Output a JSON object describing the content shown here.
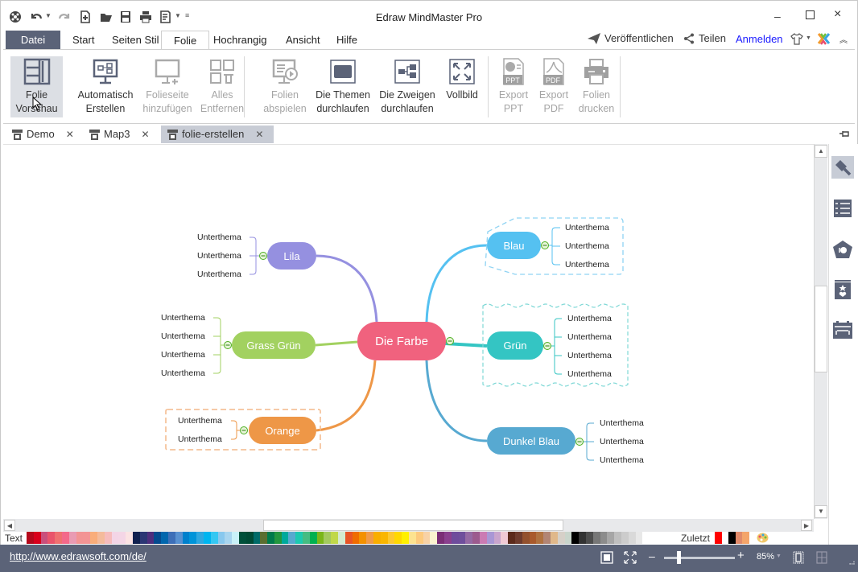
{
  "window": {
    "title": "Edraw MindMaster Pro"
  },
  "quick_access": [
    "app-logo-icon",
    "undo-icon",
    "redo-icon",
    "new-icon",
    "open-icon",
    "save-icon",
    "print-icon",
    "export-icon"
  ],
  "menu": {
    "file": "Datei",
    "tabs": [
      "Start",
      "Seiten Stil",
      "Folie",
      "Hochrangig",
      "Ansicht",
      "Hilfe"
    ],
    "active": "Folie",
    "publish": "Veröffentlichen",
    "share": "Teilen",
    "login": "Anmelden"
  },
  "ribbon": [
    {
      "l1": "Folie",
      "l2": "Vorschau",
      "enabled": true,
      "selected": true
    },
    {
      "l1": "Automatisch",
      "l2": "Erstellen",
      "enabled": true
    },
    {
      "l1": "Folieseite",
      "l2": "hinzufügen",
      "enabled": false
    },
    {
      "l1": "Alles",
      "l2": "Entfernen",
      "enabled": false
    },
    {
      "l1": "Folien",
      "l2": "abspielen",
      "enabled": false
    },
    {
      "l1": "Die Themen",
      "l2": "durchlaufen",
      "enabled": true
    },
    {
      "l1": "Die Zweigen",
      "l2": "durchlaufen",
      "enabled": true
    },
    {
      "l1": "Vollbild",
      "l2": "",
      "enabled": true
    },
    {
      "l1": "Export",
      "l2": "PPT",
      "enabled": false,
      "badge": "PPT"
    },
    {
      "l1": "Export",
      "l2": "PDF",
      "enabled": false,
      "badge": "PDF"
    },
    {
      "l1": "Folien",
      "l2": "drucken",
      "enabled": false
    }
  ],
  "doc_tabs": [
    {
      "label": "Demo"
    },
    {
      "label": "Map3"
    },
    {
      "label": "folie-erstellen",
      "active": true
    }
  ],
  "mindmap": {
    "central": {
      "label": "Die Farbe",
      "color": "#f0627e"
    },
    "topics": [
      {
        "label": "Lila",
        "color": "#9590e0",
        "subs": [
          "Unterthema",
          "Unterthema",
          "Unterthema"
        ]
      },
      {
        "label": "Grass Grün",
        "color": "#a2d160",
        "subs": [
          "Unterthema",
          "Unterthema",
          "Unterthema",
          "Unterthema"
        ]
      },
      {
        "label": "Orange",
        "color": "#ee9747",
        "subs": [
          "Unterthema",
          "Unterthema"
        ]
      },
      {
        "label": "Blau",
        "color": "#55c1f1",
        "subs": [
          "Unterthema",
          "Unterthema",
          "Unterthema"
        ]
      },
      {
        "label": "Grün",
        "color": "#34c5c3",
        "subs": [
          "Unterthema",
          "Unterthema",
          "Unterthema",
          "Unterthema"
        ]
      },
      {
        "label": "Dunkel Blau",
        "color": "#57a9d1",
        "subs": [
          "Unterthema",
          "Unterthema",
          "Unterthema"
        ]
      }
    ]
  },
  "sidebar": [
    "paint-brush-icon",
    "outline-list-icon",
    "clipart-icon",
    "badge-icon",
    "calendar-icon"
  ],
  "palette": {
    "text_label": "Text",
    "recent_label": "Zuletzt",
    "colors": [
      "#b5081b",
      "#d9001b",
      "#c94f7c",
      "#e9546b",
      "#ef7070",
      "#f3698a",
      "#e99bb3",
      "#f29494",
      "#f39494",
      "#f9ad7a",
      "#f4bb9b",
      "#f6bcbc",
      "#f3d5e6",
      "#f4d6e6",
      "#fbe3e3",
      "#10204f",
      "#2b3674",
      "#4e2e7d",
      "#054a8e",
      "#0166ad",
      "#3d6fb8",
      "#5891d1",
      "#0080cc",
      "#0094d9",
      "#2fa8e0",
      "#00b5ef",
      "#35c7f2",
      "#88c8ee",
      "#a8d5ef",
      "#c9f1f8",
      "#00503a",
      "#004b35",
      "#006b68",
      "#5a6e30",
      "#007a4b",
      "#23963e",
      "#00a99c",
      "#57a9cf",
      "#1dc9b0",
      "#45bc82",
      "#00b050",
      "#7bb61a",
      "#a3c95e",
      "#c0d84a",
      "#d4ead0",
      "#e75426",
      "#ef6c00",
      "#f39100",
      "#f19a48",
      "#f9ae00",
      "#fab600",
      "#fdc82f",
      "#ffd800",
      "#fff000",
      "#fde390",
      "#fdca7d",
      "#f8d2a6",
      "#fbf4cf",
      "#7b2e76",
      "#8a3f8e",
      "#6e4c9c",
      "#6f4f9c",
      "#956aa4",
      "#9c5b8e",
      "#cb7bb3",
      "#a997d5",
      "#c9a5cd",
      "#f1cad5",
      "#5c2a1b",
      "#6e3b2d",
      "#93512e",
      "#a95a2c",
      "#b07240",
      "#b28574",
      "#e0b88a",
      "#d6d0c8",
      "#c9d5cb",
      "#000000",
      "#333333",
      "#4d4d4d",
      "#777777",
      "#8c8c8c",
      "#a6a6a6",
      "#bfbfbf",
      "#cccccc",
      "#d9d9d9",
      "#e8e8e8"
    ],
    "recent": [
      "#ff0000",
      "#ffffff",
      "#000000",
      "#e08a6a",
      "#f4a56a"
    ]
  },
  "status": {
    "url": "http://www.edrawsoft.com/de/",
    "zoom": "85%",
    "zoom_level": 0.2
  },
  "colors": {
    "dark_bar": "#5b6378",
    "accent_link": "#1a1aff"
  }
}
